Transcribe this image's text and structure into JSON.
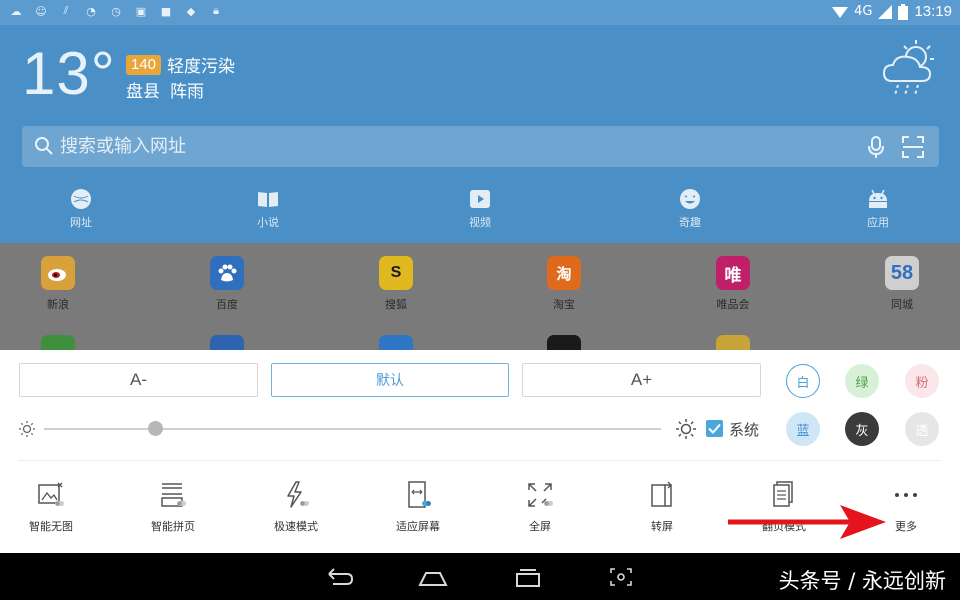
{
  "status_bar": {
    "time": "13:19",
    "network": "4G",
    "left_icons": [
      "cloud-icon",
      "person-icon",
      "signal-lines-icon",
      "wifi-icon",
      "clock-icon",
      "image-icon",
      "app-icon",
      "notification-icon",
      "lock-icon"
    ]
  },
  "weather": {
    "temperature": "13°",
    "aqi_value": "140",
    "aqi_text": "轻度污染",
    "city": "盘县",
    "condition": "阵雨"
  },
  "search": {
    "placeholder": "搜索或输入网址"
  },
  "nav": [
    {
      "label": "网址",
      "icon": "globe-icon"
    },
    {
      "label": "小说",
      "icon": "book-icon"
    },
    {
      "label": "视频",
      "icon": "play-icon"
    },
    {
      "label": "奇趣",
      "icon": "smile-icon"
    },
    {
      "label": "应用",
      "icon": "android-icon"
    }
  ],
  "sites": [
    {
      "label": "新浪",
      "logo_text": "",
      "color": "#d9a13a"
    },
    {
      "label": "百度",
      "logo_text": "",
      "color": "#2f6fbd"
    },
    {
      "label": "搜狐",
      "logo_text": "S",
      "color": "#e0b820"
    },
    {
      "label": "淘宝",
      "logo_text": "淘",
      "color": "#e06a1c"
    },
    {
      "label": "唯品会",
      "logo_text": "唯",
      "color": "#c0206a"
    },
    {
      "label": "同城",
      "logo_text": "58",
      "color": "#cfcfcf"
    }
  ],
  "font_controls": {
    "decrease": "A-",
    "default": "默认",
    "increase": "A+"
  },
  "themes": [
    {
      "label": "白",
      "bg": "#ffffff",
      "fg": "#4aa0d8",
      "border": "#4aa0d8"
    },
    {
      "label": "绿",
      "bg": "#d8f0d8",
      "fg": "#4aa04a",
      "border": "#d8f0d8"
    },
    {
      "label": "粉",
      "bg": "#fbe6ea",
      "fg": "#d46f7e",
      "border": "#fbe6ea"
    },
    {
      "label": "蓝",
      "bg": "#cfe6f6",
      "fg": "#3f8ccc",
      "border": "#cfe6f6"
    },
    {
      "label": "灰",
      "bg": "#3b3b3b",
      "fg": "#ffffff",
      "border": "#3b3b3b"
    },
    {
      "label": "透",
      "bg": "#e6e6e6",
      "fg": "#ffffff",
      "border": "#e6e6e6"
    }
  ],
  "brightness": {
    "level_fraction": 0.18,
    "system_label": "系统",
    "system_checked": true
  },
  "tools": [
    {
      "label": "智能无图",
      "icon": "no-image-icon"
    },
    {
      "label": "智能拼页",
      "icon": "page-merge-icon"
    },
    {
      "label": "极速模式",
      "icon": "lightning-icon"
    },
    {
      "label": "适应屏幕",
      "icon": "fit-screen-icon"
    },
    {
      "label": "全屏",
      "icon": "fullscreen-icon"
    },
    {
      "label": "转屏",
      "icon": "rotate-screen-icon"
    },
    {
      "label": "翻页模式",
      "icon": "page-turn-icon"
    },
    {
      "label": "更多",
      "icon": "more-icon"
    }
  ],
  "watermark": "头条号 / 永远创新",
  "colors": {
    "header_bg": "#4a90c6",
    "accent": "#4aa6dd",
    "annotation_arrow": "#e3141b"
  }
}
